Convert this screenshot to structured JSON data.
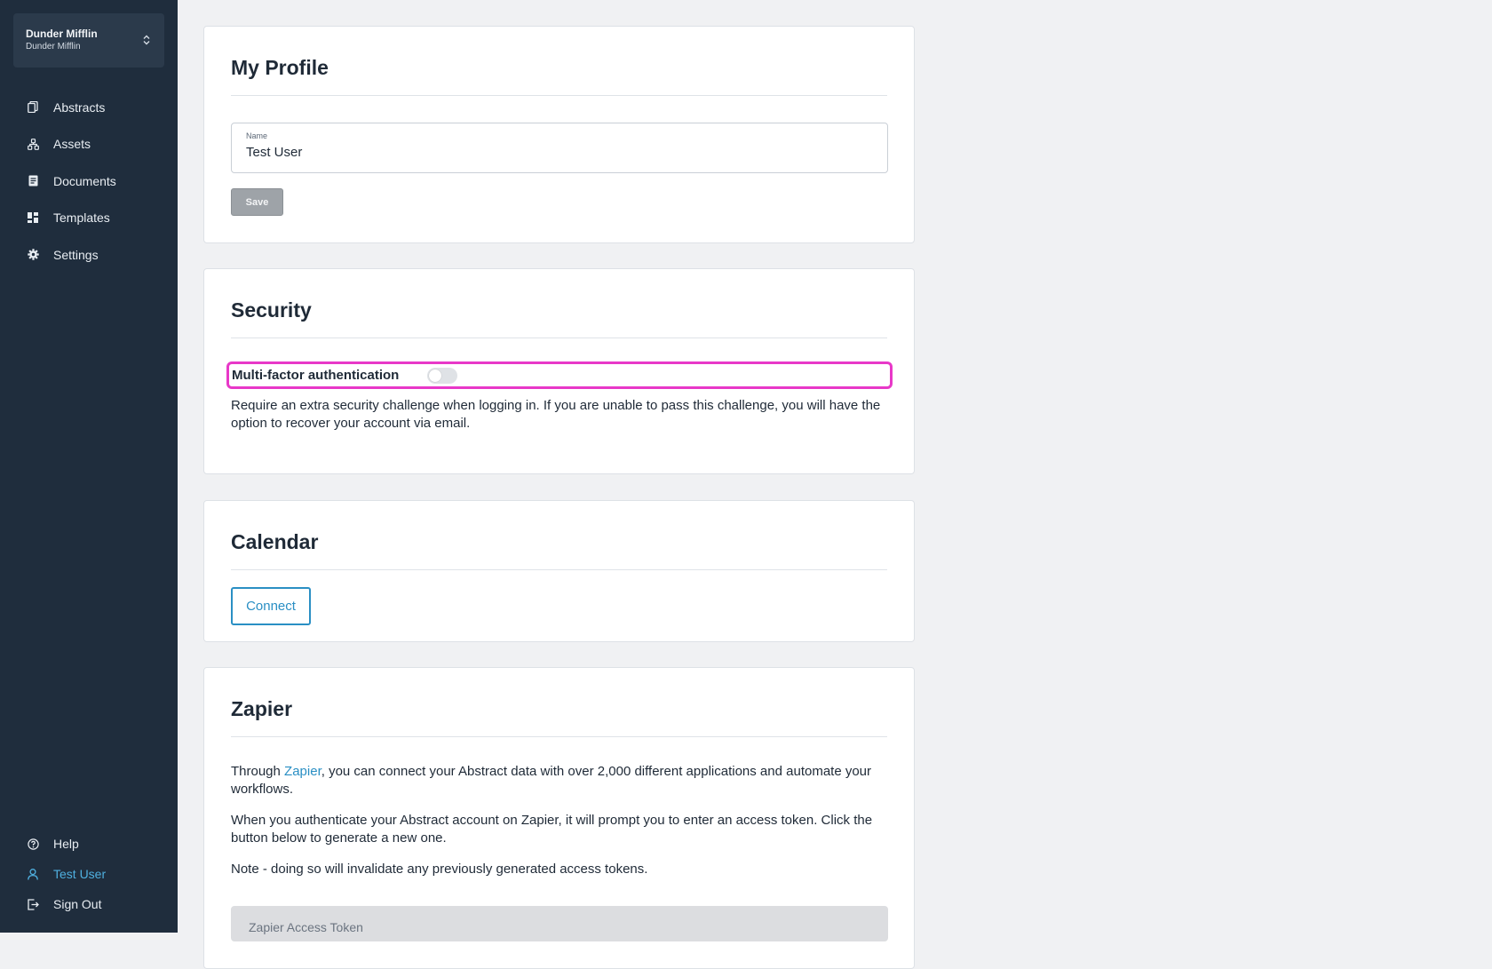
{
  "sidebar": {
    "org": {
      "name": "Dunder Mifflin",
      "subname": "Dunder Mifflin"
    },
    "items": [
      {
        "label": "Abstracts",
        "icon": "abstracts-icon"
      },
      {
        "label": "Assets",
        "icon": "assets-icon"
      },
      {
        "label": "Documents",
        "icon": "documents-icon"
      },
      {
        "label": "Templates",
        "icon": "templates-icon"
      },
      {
        "label": "Settings",
        "icon": "gear-icon"
      }
    ],
    "bottom": [
      {
        "label": "Help",
        "icon": "help-icon"
      },
      {
        "label": "Test User",
        "icon": "user-icon",
        "active": true
      },
      {
        "label": "Sign Out",
        "icon": "sign-out-icon"
      }
    ]
  },
  "profile": {
    "title": "My Profile",
    "name_label": "Name",
    "name_value": "Test User",
    "save_label": "Save"
  },
  "security": {
    "title": "Security",
    "mfa_label": "Multi-factor authentication",
    "mfa_enabled": false,
    "description": "Require an extra security challenge when logging in. If you are unable to pass this challenge, you will have the option to recover your account via email."
  },
  "calendar": {
    "title": "Calendar",
    "connect_label": "Connect"
  },
  "zapier": {
    "title": "Zapier",
    "p1_before": "Through ",
    "p1_link": "Zapier",
    "p1_after": ", you can connect your Abstract data with over 2,000 different applications and automate your workflows.",
    "p2": "When you authenticate your Abstract account on Zapier, it will prompt you to enter an access token. Click the button below to generate a new one.",
    "p3": "Note - doing so will invalidate any previously generated access tokens.",
    "token_placeholder": "Zapier Access Token"
  },
  "colors": {
    "sidebar_bg": "#1f2d3d",
    "accent": "#2a8fc4",
    "highlight": "#e838c8"
  }
}
